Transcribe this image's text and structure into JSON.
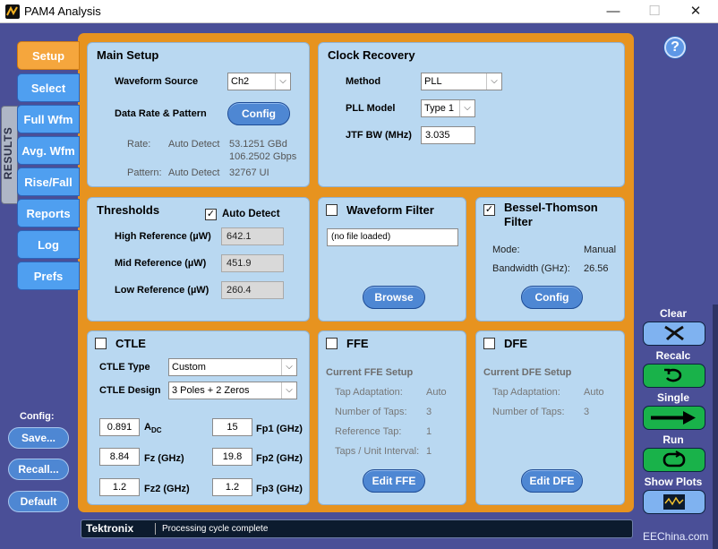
{
  "window": {
    "title": "PAM4 Analysis",
    "controls": {
      "minimize": "—",
      "maximize": "☐",
      "close": "✕"
    }
  },
  "help": {
    "label": "?"
  },
  "nav": {
    "tabs": [
      {
        "label": "Setup",
        "active": true
      },
      {
        "label": "Select"
      },
      {
        "label": "Full Wfm"
      },
      {
        "label": "Avg. Wfm"
      },
      {
        "label": "Rise/Fall"
      },
      {
        "label": "Reports"
      },
      {
        "label": "Log"
      },
      {
        "label": "Prefs"
      }
    ],
    "results_label": "RESULTS"
  },
  "main_setup": {
    "title": "Main Setup",
    "waveform_source_label": "Waveform Source",
    "waveform_source_value": "Ch2",
    "data_rate_label": "Data Rate & Pattern",
    "config_button": "Config",
    "rate_label": "Rate:",
    "rate_mode": "Auto Detect",
    "rate_gbd": "53.1251 GBd",
    "rate_gbps": "106.2502 Gbps",
    "pattern_label": "Pattern:",
    "pattern_mode": "Auto Detect",
    "pattern_value": "32767 UI"
  },
  "clock_recovery": {
    "title": "Clock Recovery",
    "method_label": "Method",
    "method_value": "PLL",
    "pll_model_label": "PLL Model",
    "pll_model_value": "Type 1",
    "jtf_label": "JTF BW (MHz)",
    "jtf_value": "3.035"
  },
  "thresholds": {
    "title": "Thresholds",
    "auto_detect_label": "Auto Detect",
    "auto_detect_checked": "✓",
    "high_label": "High Reference (µW)",
    "high_value": "642.1",
    "mid_label": "Mid Reference (µW)",
    "mid_value": "451.9",
    "low_label": "Low Reference (µW)",
    "low_value": "260.4"
  },
  "waveform_filter": {
    "title": "Waveform Filter",
    "file_value": "(no file loaded)",
    "browse_button": "Browse"
  },
  "bessel": {
    "title_line1": "Bessel-Thomson",
    "title_line2": "Filter",
    "checked": "✓",
    "mode_label": "Mode:",
    "mode_value": "Manual",
    "bw_label": "Bandwidth (GHz):",
    "bw_value": "26.56",
    "config_button": "Config"
  },
  "ctle": {
    "title": "CTLE",
    "type_label": "CTLE Type",
    "type_value": "Custom",
    "design_label": "CTLE Design",
    "design_value": "3 Poles + 2 Zeros",
    "adc_value": "0.891",
    "adc_label": "A",
    "adc_sub": "DC",
    "fp1_value": "15",
    "fp1_label": "Fp1 (GHz)",
    "fz_value": "8.84",
    "fz_label": "Fz (GHz)",
    "fp2_value": "19.8",
    "fp2_label": "Fp2 (GHz)",
    "fz2_value": "1.2",
    "fz2_label": "Fz2 (GHz)",
    "fp3_value": "1.2",
    "fp3_label": "Fp3 (GHz)"
  },
  "ffe": {
    "title": "FFE",
    "current_label": "Current FFE Setup",
    "tap_adapt_label": "Tap Adaptation:",
    "tap_adapt_value": "Auto",
    "num_taps_label": "Number of Taps:",
    "num_taps_value": "3",
    "ref_tap_label": "Reference Tap:",
    "ref_tap_value": "1",
    "taps_ui_label": "Taps / Unit Interval:",
    "taps_ui_value": "1",
    "edit_button": "Edit FFE"
  },
  "dfe": {
    "title": "DFE",
    "current_label": "Current DFE Setup",
    "tap_adapt_label": "Tap Adaptation:",
    "tap_adapt_value": "Auto",
    "num_taps_label": "Number of Taps:",
    "num_taps_value": "3",
    "edit_button": "Edit DFE"
  },
  "config_group": {
    "label": "Config:",
    "save": "Save...",
    "recall": "Recall...",
    "default": "Default"
  },
  "actions": {
    "clear": "Clear",
    "recalc": "Recalc",
    "single": "Single",
    "run": "Run",
    "show_plots": "Show Plots"
  },
  "status": {
    "brand": "Tektronix",
    "message": "Processing cycle complete"
  },
  "watermark": "EEChina.com"
}
